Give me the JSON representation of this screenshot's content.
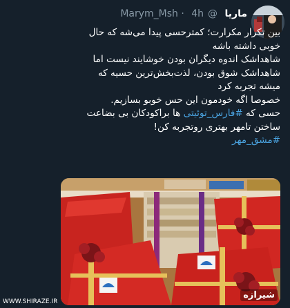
{
  "tweet": {
    "display_name": "ماریا",
    "handle": "@Marym_Msh",
    "separator": "·",
    "time": "4h",
    "lines": [
      "بین تکرار مکرارت؛ کمترحسی پیدا می‌شه که حال",
      "خوبی داشته باشه",
      "شاهداشک اندوه دیگران بودن خوشایند نیست اما",
      "شاهداشک شوق بودن، لذت‌بخش‌ترین حسیه که",
      "میشه تجربه کرد",
      "خصوصا اگه خودمون این حس خوبو بسازیم."
    ],
    "line7_before": "حسی که ",
    "line7_hashtag": "#فارس_توئیتی",
    "line7_after": " ها براکودکان بی بضاعت",
    "line8": "ساختن تامهر بهتری روتجربه کن!",
    "hashtag_line": "#مشق_مهر"
  },
  "watermark": {
    "left": "WWW.SHIRAZE.IR",
    "right": "شیرازه"
  },
  "colors": {
    "background": "#15202b",
    "link": "#4aa3e0",
    "meta": "#8899a6"
  }
}
